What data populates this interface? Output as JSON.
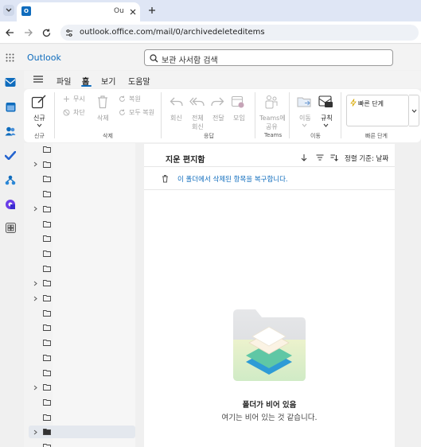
{
  "browser": {
    "tab_title": "Ou",
    "url": "outlook.office.com/mail/0/archivedeleteditems"
  },
  "app": {
    "name": "Outlook",
    "search_placeholder": "보관 사서함 검색"
  },
  "menu": {
    "items": [
      "파일",
      "홈",
      "보기",
      "도움말"
    ],
    "active": "홈"
  },
  "ribbon": {
    "new_label": "신규",
    "new_group": "신규",
    "ignore": "무시",
    "block": "차단",
    "delete": "삭제",
    "restore": "복원",
    "restore_all": "모두 복원",
    "delete_group": "삭제",
    "reply": "회신",
    "reply_all_1": "전체",
    "reply_all_2": "회신",
    "forward": "전달",
    "meeting": "모임",
    "respond_group": "응답",
    "teams_1": "Teams에",
    "teams_2": "공유",
    "teams_group": "Teams",
    "move": "이동",
    "rules": "규칙",
    "move_group": "이동",
    "quick_steps": "빠른 단계",
    "quick_steps_group": "빠른 단계"
  },
  "list": {
    "title": "지운 편지함",
    "sort_label": "정렬 기준: 날짜",
    "recover_text": "이 폴더에서 삭제된 항목을 복구합니다.",
    "empty_title": "폴더가 비어 있음",
    "empty_subtitle": "여기는 비어 있는 것 같습니다."
  },
  "colors": {
    "accent": "#0f6cbd",
    "tabbar": "#dfe6f5",
    "ribbon_disabled": "#a0a0a0"
  }
}
